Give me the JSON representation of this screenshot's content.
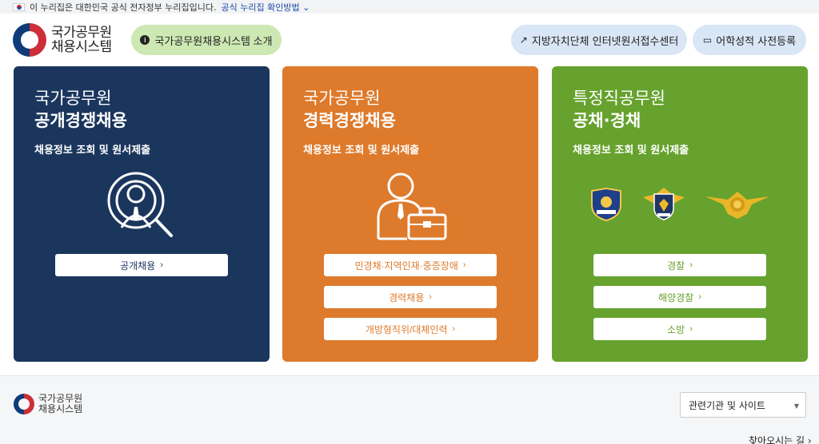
{
  "banner": {
    "notice": "이 누리집은 대한민국 공식 전자정부 누리집입니다.",
    "link": "공식 누리집 확인방법"
  },
  "header": {
    "logo_line1": "국가공무원",
    "logo_line2": "채용시스템",
    "intro_button": "국가공무원채용시스템 소개",
    "local_gov_button": "지방자치단체 인터넷원서접수센터",
    "lang_button": "어학성적 사전등록"
  },
  "cards": [
    {
      "title_line1": "국가공무원",
      "title_line2": "공개경쟁채용",
      "subtitle": "채용정보 조회 및 원서제출",
      "buttons": [
        "공개채용"
      ]
    },
    {
      "title_line1": "국가공무원",
      "title_line2": "경력경쟁채용",
      "subtitle": "채용정보 조회 및 원서제출",
      "buttons": [
        "민경채·지역인재·중증장애",
        "경력채용",
        "개방형직위/대체인력"
      ]
    },
    {
      "title_line1": "특정직공무원",
      "title_line2": "공채·경채",
      "subtitle": "채용정보 조회 및 원서제출",
      "buttons": [
        "경찰",
        "해양경찰",
        "소방"
      ]
    }
  ],
  "footer": {
    "logo_line1": "국가공무원",
    "logo_line2": "채용시스템",
    "related_select": "관련기관 및 사이트",
    "directions": "찾아오시는 길"
  },
  "colors": {
    "blue": "#1b365d",
    "orange": "#de7a2b",
    "green": "#66a22d",
    "intro_bg": "#cde8b3",
    "pill_bg": "#d8e6f5"
  }
}
